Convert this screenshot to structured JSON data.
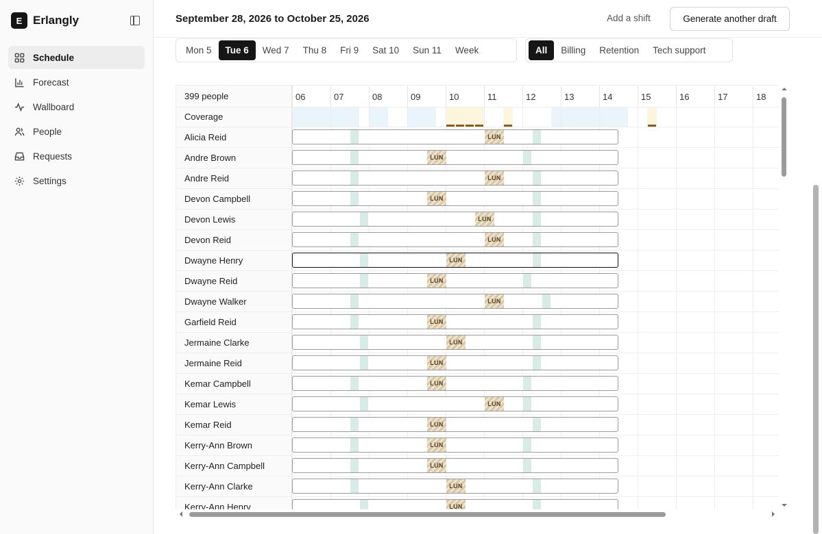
{
  "app": {
    "logo_letter": "E",
    "name": "Erlangly"
  },
  "sidebar": {
    "items": [
      {
        "label": "Schedule",
        "icon": "grid-icon",
        "active": true
      },
      {
        "label": "Forecast",
        "icon": "bar-chart-icon",
        "active": false
      },
      {
        "label": "Wallboard",
        "icon": "activity-icon",
        "active": false
      },
      {
        "label": "People",
        "icon": "users-icon",
        "active": false
      },
      {
        "label": "Requests",
        "icon": "inbox-icon",
        "active": false
      },
      {
        "label": "Settings",
        "icon": "gear-icon",
        "active": false
      }
    ]
  },
  "header": {
    "date_range": "September 28, 2026 to October 25, 2026",
    "add_shift_label": "Add a shift",
    "generate_label": "Generate another draft"
  },
  "day_tabs": [
    {
      "label": "Mon 5",
      "active": false
    },
    {
      "label": "Tue 6",
      "active": true
    },
    {
      "label": "Wed 7",
      "active": false
    },
    {
      "label": "Thu 8",
      "active": false
    },
    {
      "label": "Fri 9",
      "active": false
    },
    {
      "label": "Sat 10",
      "active": false
    },
    {
      "label": "Sun 11",
      "active": false
    },
    {
      "label": "Week",
      "active": false
    }
  ],
  "team_tabs": [
    {
      "label": "All",
      "active": true
    },
    {
      "label": "Billing",
      "active": false
    },
    {
      "label": "Retention",
      "active": false
    },
    {
      "label": "Tech support",
      "active": false
    }
  ],
  "grid": {
    "people_count": "399 people",
    "coverage_label": "Coverage",
    "lunch_label": "LUN",
    "hours": [
      "06",
      "07",
      "08",
      "09",
      "10",
      "11",
      "12",
      "13",
      "14",
      "15",
      "16",
      "17",
      "18"
    ],
    "coverage_warn_hours": [
      10.0,
      10.25,
      10.5,
      10.75,
      11.5,
      15.25
    ],
    "coverage_ok_hours": [
      6.0,
      6.25,
      6.5,
      6.75,
      7.0,
      7.25,
      7.5,
      8.0,
      8.25,
      9.0,
      9.25,
      9.5,
      12.75,
      13.0,
      13.25,
      13.5,
      13.75,
      14.0,
      14.25,
      14.5
    ],
    "rows": [
      {
        "name": "Alicia Reid",
        "start": 6.0,
        "end": 14.5,
        "breaks": [
          7.5,
          12.25
        ],
        "lunch": 11.0
      },
      {
        "name": "Andre Brown",
        "start": 6.0,
        "end": 14.5,
        "breaks": [
          7.5,
          12.0
        ],
        "lunch": 9.5
      },
      {
        "name": "Andre Reid",
        "start": 6.0,
        "end": 14.5,
        "breaks": [
          7.5,
          12.25
        ],
        "lunch": 11.0
      },
      {
        "name": "Devon Campbell",
        "start": 6.0,
        "end": 14.5,
        "breaks": [
          7.5,
          12.25
        ],
        "lunch": 9.5
      },
      {
        "name": "Devon Lewis",
        "start": 6.0,
        "end": 14.5,
        "breaks": [
          7.75,
          12.25
        ],
        "lunch": 10.75
      },
      {
        "name": "Devon Reid",
        "start": 6.0,
        "end": 14.5,
        "breaks": [
          7.5,
          12.25
        ],
        "lunch": 11.0
      },
      {
        "name": "Dwayne Henry",
        "start": 6.0,
        "end": 14.5,
        "breaks": [
          7.75,
          12.25
        ],
        "lunch": 10.0,
        "selected": true
      },
      {
        "name": "Dwayne Reid",
        "start": 6.0,
        "end": 14.5,
        "breaks": [
          7.75,
          12.0
        ],
        "lunch": 9.5
      },
      {
        "name": "Dwayne Walker",
        "start": 6.0,
        "end": 14.5,
        "breaks": [
          7.5,
          12.5
        ],
        "lunch": 11.0
      },
      {
        "name": "Garfield Reid",
        "start": 6.0,
        "end": 14.5,
        "breaks": [
          7.5,
          12.25
        ],
        "lunch": 9.5
      },
      {
        "name": "Jermaine Clarke",
        "start": 6.0,
        "end": 14.5,
        "breaks": [
          7.75,
          12.25
        ],
        "lunch": 10.0
      },
      {
        "name": "Jermaine Reid",
        "start": 6.0,
        "end": 14.5,
        "breaks": [
          7.75,
          12.25
        ],
        "lunch": 9.5
      },
      {
        "name": "Kemar Campbell",
        "start": 6.0,
        "end": 14.5,
        "breaks": [
          7.5,
          12.0
        ],
        "lunch": 9.5
      },
      {
        "name": "Kemar Lewis",
        "start": 6.0,
        "end": 14.5,
        "breaks": [
          7.75,
          12.0
        ],
        "lunch": 11.0
      },
      {
        "name": "Kemar Reid",
        "start": 6.0,
        "end": 14.5,
        "breaks": [
          7.5,
          12.25
        ],
        "lunch": 9.5
      },
      {
        "name": "Kerry-Ann Brown",
        "start": 6.0,
        "end": 14.5,
        "breaks": [
          7.5,
          12.0
        ],
        "lunch": 9.5
      },
      {
        "name": "Kerry-Ann Campbell",
        "start": 6.0,
        "end": 14.5,
        "breaks": [
          7.5,
          12.0
        ],
        "lunch": 9.5
      },
      {
        "name": "Kerry-Ann Clarke",
        "start": 6.0,
        "end": 14.5,
        "breaks": [
          7.5,
          12.25
        ],
        "lunch": 10.0
      },
      {
        "name": "Kerry-Ann Henry",
        "start": 6.0,
        "end": 14.5,
        "breaks": [
          7.75,
          12.25
        ],
        "lunch": 10.0
      }
    ]
  }
}
